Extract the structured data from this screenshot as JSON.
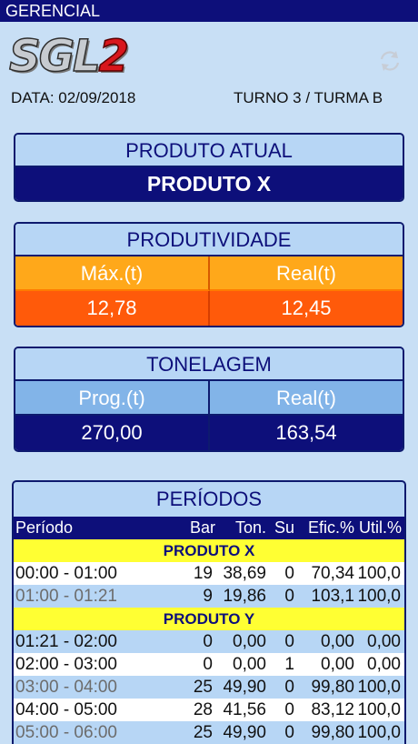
{
  "topbar": {
    "title": "GERENCIAL"
  },
  "logo": {
    "main": "SGL",
    "num": "2"
  },
  "info": {
    "date": "DATA: 02/09/2018",
    "shift": "TURNO 3 / TURMA B"
  },
  "produto_atual": {
    "title": "PRODUTO ATUAL",
    "value": "PRODUTO X"
  },
  "produtividade": {
    "title": "PRODUTIVIDADE",
    "max_label": "Máx.(t)",
    "real_label": "Real(t)",
    "max_value": "12,78",
    "real_value": "12,45"
  },
  "tonelagem": {
    "title": "TONELAGEM",
    "prog_label": "Prog.(t)",
    "real_label": "Real(t)",
    "prog_value": "270,00",
    "real_value": "163,54"
  },
  "periodos": {
    "title": "PERÍODOS",
    "columns": {
      "periodo": "Período",
      "bar": "Bar",
      "ton": "Ton.",
      "su": "Su",
      "efic": "Efic.%",
      "util": "Util.%"
    },
    "groups": [
      "PRODUTO X",
      "PRODUTO Y"
    ],
    "rows": [
      {
        "periodo": "00:00 - 01:00",
        "bar": "19",
        "ton": "38,69",
        "su": "0",
        "efic": "70,34",
        "util": "100,0"
      },
      {
        "periodo": "01:00 - 01:21",
        "bar": "9",
        "ton": "19,86",
        "su": "0",
        "efic": "103,1",
        "util": "100,0"
      },
      {
        "periodo": "01:21 - 02:00",
        "bar": "0",
        "ton": "0,00",
        "su": "0",
        "efic": "0,00",
        "util": "0,00"
      },
      {
        "periodo": "02:00 - 03:00",
        "bar": "0",
        "ton": "0,00",
        "su": "1",
        "efic": "0,00",
        "util": "0,00"
      },
      {
        "periodo": "03:00 - 04:00",
        "bar": "25",
        "ton": "49,90",
        "su": "0",
        "efic": "99,80",
        "util": "100,0"
      },
      {
        "periodo": "04:00 - 05:00",
        "bar": "28",
        "ton": "41,56",
        "su": "0",
        "efic": "83,12",
        "util": "100,0"
      },
      {
        "periodo": "05:00 - 06:00",
        "bar": "25",
        "ton": "49,90",
        "su": "0",
        "efic": "99,80",
        "util": "100,0"
      }
    ]
  }
}
